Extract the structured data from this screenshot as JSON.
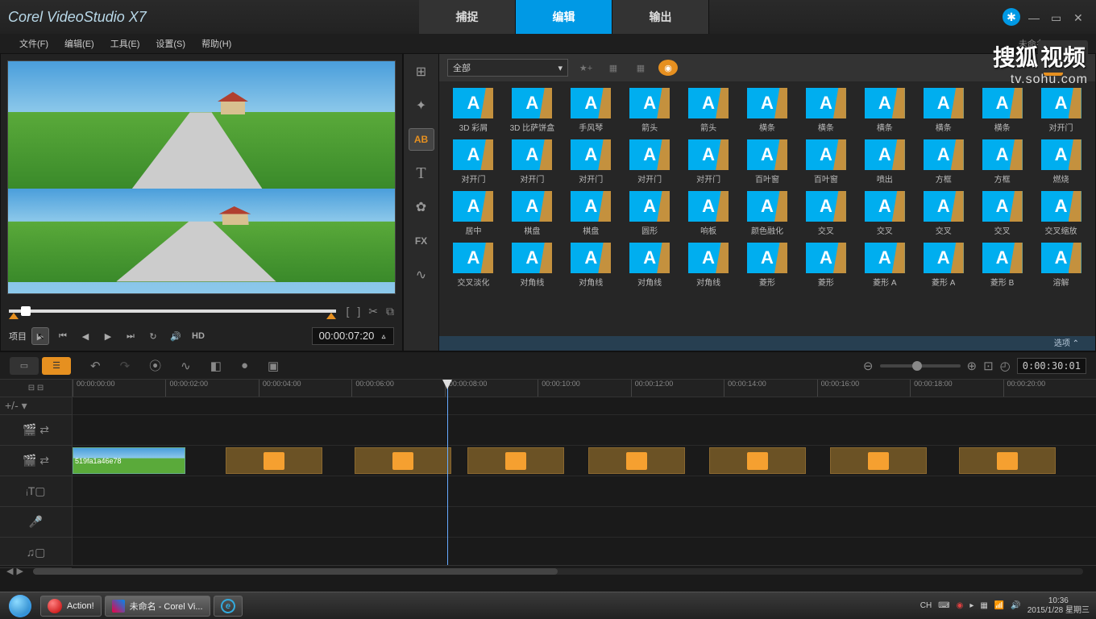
{
  "app": {
    "title": "Corel  VideoStudio X7"
  },
  "tabs": {
    "capture": "捕捉",
    "edit": "编辑",
    "output": "输出"
  },
  "menu": [
    "文件(F)",
    "编辑(E)",
    "工具(E)",
    "设置(S)",
    "帮助(H)"
  ],
  "status": "未命名, 720*576",
  "preview": {
    "label": "项目",
    "timecode": "00:00:07:20",
    "hd": "HD"
  },
  "library": {
    "filter": "全部",
    "footer": "选项  ⌃",
    "sideIcons": [
      "media",
      "transition",
      "title-ab",
      "title-t",
      "graphic",
      "fx",
      "path"
    ],
    "items": [
      "3D 彩屑",
      "3D 比萨饼盒",
      "手风琴",
      "箭头",
      "箭头",
      "横条",
      "横条",
      "横条",
      "横条",
      "横条",
      "对开门",
      "对开门",
      "对开门",
      "对开门",
      "对开门",
      "对开门",
      "百叶窗",
      "百叶窗",
      "喷出",
      "方框",
      "方框",
      "燃烧",
      "居中",
      "棋盘",
      "棋盘",
      "圆形",
      "响板",
      "颜色融化",
      "交叉",
      "交叉",
      "交叉",
      "交叉",
      "交叉缩放",
      "交叉淡化",
      "对角线",
      "对角线",
      "对角线",
      "对角线",
      "菱形",
      "菱形",
      "菱形 A",
      "菱形 A",
      "菱形 B",
      "溶解"
    ]
  },
  "timeline": {
    "duration": "0:00:30:01",
    "ruler": [
      "00:00:00:00",
      "00:00:02:00",
      "00:00:04:00",
      "00:00:06:00",
      "00:00:08:00",
      "00:00:10:00",
      "00:00:12:00",
      "00:00:14:00",
      "00:00:16:00",
      "00:00:18:00",
      "00:00:20:00"
    ],
    "clipName": "519fa1a46e78",
    "transitionPositions": [
      190,
      350,
      490,
      640,
      790,
      940,
      1100
    ]
  },
  "taskbar": {
    "items": [
      "Action!",
      "未命名 - Corel Vi..."
    ],
    "lang": "CH",
    "time": "10:36",
    "date": "2015/1/28 星期三"
  },
  "watermark": {
    "main": "搜狐",
    "box": "视频",
    "sub": "tv.sohu.com"
  }
}
